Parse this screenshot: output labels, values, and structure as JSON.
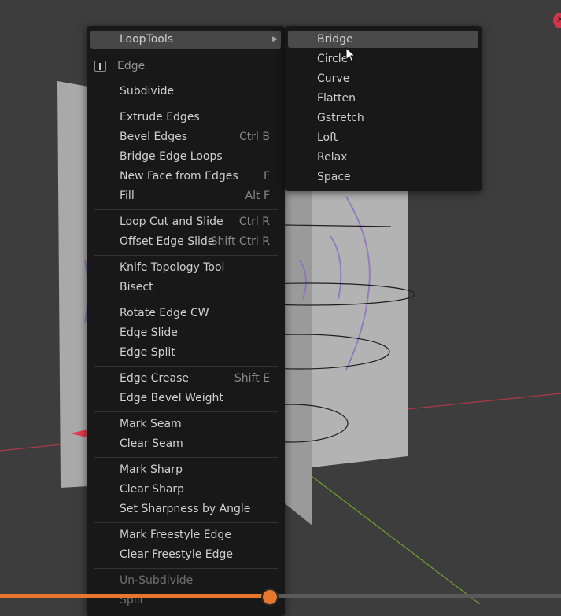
{
  "colors": {
    "viewport_background": "#3d3d3d",
    "menu_background": "#181818",
    "highlight": "#474747",
    "timeline_accent": "#e8772e",
    "x_axis": "#c8394a",
    "y_axis": "#6c9a2e"
  },
  "edge_menu": {
    "top_item": {
      "label": "LoopTools",
      "has_submenu": true
    },
    "title": {
      "icon": "edge-select-icon",
      "label": "Edge"
    },
    "groups": [
      [
        {
          "label": "Subdivide",
          "shortcut": ""
        }
      ],
      [
        {
          "label": "Extrude Edges",
          "shortcut": ""
        },
        {
          "label": "Bevel Edges",
          "shortcut": "Ctrl B"
        },
        {
          "label": "Bridge Edge Loops",
          "shortcut": ""
        },
        {
          "label": "New Face from Edges",
          "shortcut": "F"
        },
        {
          "label": "Fill",
          "shortcut": "Alt F"
        }
      ],
      [
        {
          "label": "Loop Cut and Slide",
          "shortcut": "Ctrl R"
        },
        {
          "label": "Offset Edge Slide",
          "shortcut": "Shift Ctrl R"
        }
      ],
      [
        {
          "label": "Knife Topology Tool",
          "shortcut": ""
        },
        {
          "label": "Bisect",
          "shortcut": ""
        }
      ],
      [
        {
          "label": "Rotate Edge CW",
          "shortcut": ""
        },
        {
          "label": "Edge Slide",
          "shortcut": ""
        },
        {
          "label": "Edge Split",
          "shortcut": ""
        }
      ],
      [
        {
          "label": "Edge Crease",
          "shortcut": "Shift E"
        },
        {
          "label": "Edge Bevel Weight",
          "shortcut": ""
        }
      ],
      [
        {
          "label": "Mark Seam",
          "shortcut": ""
        },
        {
          "label": "Clear Seam",
          "shortcut": ""
        }
      ],
      [
        {
          "label": "Mark Sharp",
          "shortcut": ""
        },
        {
          "label": "Clear Sharp",
          "shortcut": ""
        },
        {
          "label": "Set Sharpness by Angle",
          "shortcut": ""
        }
      ],
      [
        {
          "label": "Mark Freestyle Edge",
          "shortcut": ""
        },
        {
          "label": "Clear Freestyle Edge",
          "shortcut": ""
        }
      ],
      [
        {
          "label": "Un-Subdivide",
          "shortcut": "",
          "disabled": true
        },
        {
          "label": "Split",
          "shortcut": "",
          "disabled": true
        }
      ]
    ]
  },
  "looptools_submenu": {
    "items": [
      {
        "label": "Bridge",
        "highlighted": true
      },
      {
        "label": "Circle"
      },
      {
        "label": "Curve"
      },
      {
        "label": "Flatten"
      },
      {
        "label": "Gstretch"
      },
      {
        "label": "Loft"
      },
      {
        "label": "Relax"
      },
      {
        "label": "Space"
      }
    ]
  },
  "timeline": {
    "progress": 0.48
  }
}
